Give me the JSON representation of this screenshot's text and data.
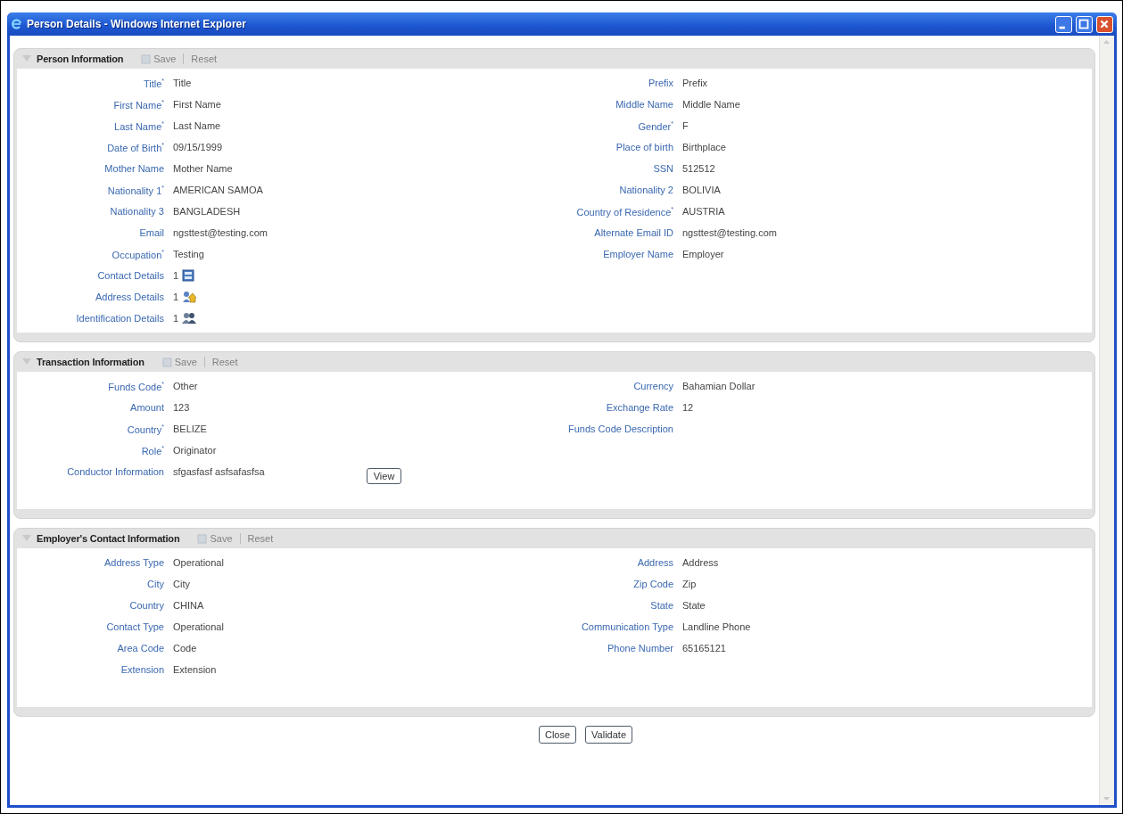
{
  "window": {
    "title": "Person Details - Windows Internet Explorer"
  },
  "sections": [
    {
      "title": "Person Information",
      "toolbar": [
        {
          "label": "Save",
          "disabled": true
        },
        {
          "label": "Reset",
          "disabled": true
        }
      ],
      "left": [
        {
          "label": "Title$^{*}$",
          "value": "Title",
          "kind": "text"
        },
        {
          "label": "First Name$^{*}$",
          "value": "First Name",
          "kind": "text"
        },
        {
          "label": "Last Name$^{*}$",
          "value": "Last Name",
          "kind": "text"
        },
        {
          "label": "Date of Birth$^{*}$",
          "value": "09/15/1999",
          "kind": "text"
        },
        {
          "label": "Mother Name",
          "value": "Mother Name",
          "kind": "text"
        },
        {
          "label": "Nationality 1$^{*}$",
          "value": "AMERICAN SAMOA",
          "kind": "text"
        },
        {
          "label": "Nationality 3",
          "value": "BANGLADESH",
          "kind": "text"
        },
        {
          "label": "Email",
          "value": "ngsttest@testing.com",
          "kind": "text"
        },
        {
          "label": "Occupation$^{*}$",
          "value": "Testing",
          "kind": "text"
        },
        {
          "label": "Contact Details",
          "value": "1",
          "kind": "contacts"
        },
        {
          "label": "Address Details",
          "value": "1",
          "kind": "addresses"
        },
        {
          "label": "Identification Details",
          "value": "1",
          "kind": "identities"
        }
      ],
      "right": [
        {
          "label": "Prefix",
          "value": "Prefix",
          "kind": "text"
        },
        {
          "label": "Middle Name",
          "value": "Middle Name",
          "kind": "text"
        },
        {
          "label": "Gender$^{*}$",
          "value": "F",
          "kind": "text"
        },
        {
          "label": "Place of birth",
          "value": "Birthplace",
          "kind": "text"
        },
        {
          "label": "SSN",
          "value": "512512",
          "kind": "text"
        },
        {
          "label": "Nationality 2",
          "value": "BOLIVIA",
          "kind": "text"
        },
        {
          "label": "Country of Residence$^{*}$",
          "value": "AUSTRIA",
          "kind": "text"
        },
        {
          "label": "Alternate Email ID",
          "value": "ngsttest@testing.com",
          "kind": "text"
        },
        {
          "label": "Employer Name",
          "value": "Employer",
          "kind": "text"
        }
      ]
    },
    {
      "title": "Transaction Information",
      "toolbar": [
        {
          "label": "Save",
          "disabled": true
        },
        {
          "label": "Reset",
          "disabled": true
        }
      ],
      "left": [
        {
          "label": "Funds Code$^{*}$",
          "value": "Other",
          "kind": "text"
        },
        {
          "label": "Amount",
          "value": "123",
          "kind": "text"
        },
        {
          "label": "Country$^{*}$",
          "value": "BELIZE",
          "kind": "text"
        },
        {
          "label": "Role$^{*}$",
          "value": "Originator",
          "kind": "text"
        },
        {
          "label": "Conductor Information",
          "value": "sfgasfasf asfsafasfsa",
          "kind": "text",
          "button": "View"
        }
      ],
      "right": [
        {
          "label": "Currency",
          "value": "Bahamian Dollar",
          "kind": "text"
        },
        {
          "label": "Exchange Rate",
          "value": "12",
          "kind": "text"
        },
        {
          "label": "Funds Code Description",
          "kind": "text"
        }
      ]
    },
    {
      "title": "Employer's Contact Information",
      "toolbar": [
        {
          "label": "Save",
          "disabled": true
        },
        {
          "label": "Reset",
          "disabled": true
        }
      ],
      "left": [
        {
          "label": "Address Type",
          "value": "Operational",
          "kind": "text"
        },
        {
          "label": "City",
          "value": "City",
          "kind": "text"
        },
        {
          "label": "Country",
          "value": "CHINA",
          "kind": "text"
        },
        {
          "label": "Contact Type",
          "value": "Operational",
          "kind": "text"
        },
        {
          "label": "Area Code",
          "value": "Code",
          "kind": "text"
        },
        {
          "label": "Extension",
          "value": "Extension",
          "kind": "text"
        }
      ],
      "right": [
        {
          "label": "Address",
          "value": "Address",
          "kind": "text"
        },
        {
          "label": "Zip Code",
          "value": "Zip",
          "kind": "text"
        },
        {
          "label": "State",
          "value": "State",
          "kind": "text"
        },
        {
          "label": "Communication Type",
          "value": "Landline Phone",
          "kind": "text"
        },
        {
          "label": "Phone Number",
          "value": "65165121",
          "kind": "text"
        }
      ]
    }
  ],
  "buttons": [
    "Close",
    "Validate"
  ]
}
